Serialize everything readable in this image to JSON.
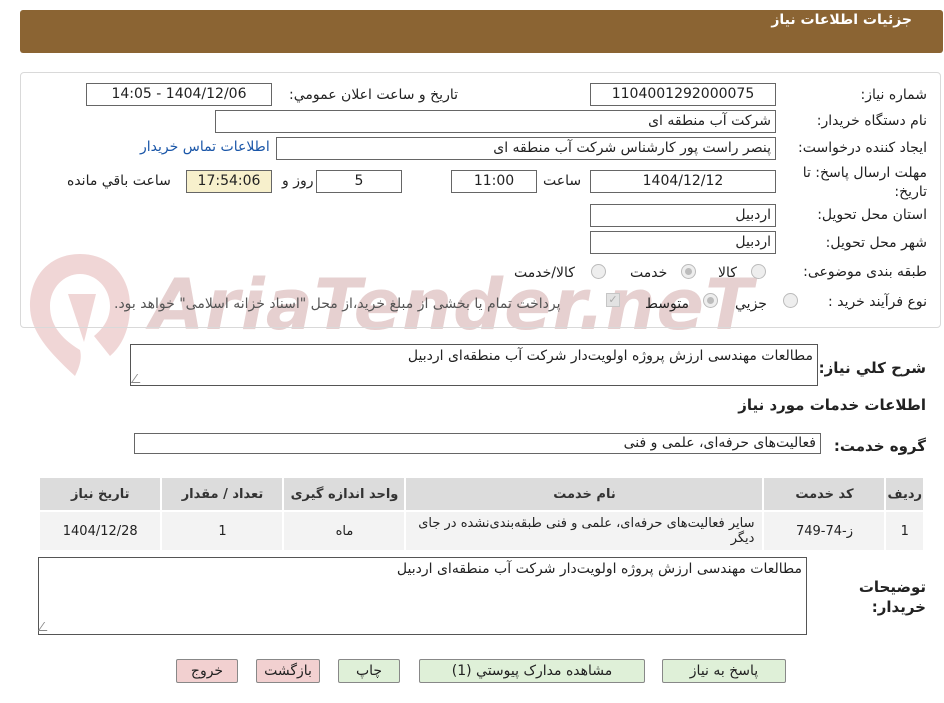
{
  "header": {
    "title": "جزئیات اطلاعات نیاز"
  },
  "watermark": "AriaTender.neT",
  "form": {
    "need_number_label": "شماره نیاز:",
    "need_number": "1104001292000075",
    "announce_label": "تاریخ و ساعت اعلان عمومي:",
    "announce_value": "1404/12/06 - 14:05",
    "buyer_org_label": "نام دستگاه خريدار:",
    "buyer_org": "شرکت آب منطقه ای",
    "requester_label": "ايجاد کننده درخواست:",
    "requester": "پنصر راست پور کارشناس شرکت آب منطقه ای",
    "contact_link": "اطلاعات تماس خريدار",
    "deadline_label": "مهلت ارسال پاسخ: تا تاریخ:",
    "deadline_date": "1404/12/12",
    "time_label": "ساعت",
    "deadline_time": "11:00",
    "days_value": "5",
    "days_label": "روز و",
    "remaining_time": "17:54:06",
    "remaining_label": "ساعت باقي مانده",
    "province_label": "استان محل تحويل:",
    "province": "اردبیل",
    "city_label": "شهر محل تحويل:",
    "city": "اردبیل",
    "category_label": "طبقه بندی موضوعی:",
    "category_options": [
      "کالا",
      "خدمت",
      "کالا/خدمت"
    ],
    "category_selected": "خدمت",
    "process_label": "نوع فرآیند خرید :",
    "process_options": [
      "جزيي",
      "متوسط"
    ],
    "process_selected": "متوسط",
    "payment_note": "پرداخت تمام یا بخشی از مبلغ خرید،از محل \"اسناد خزانه اسلامی\" خواهد بود."
  },
  "summary": {
    "label": "شرح کلي نياز:",
    "value": "مطالعات مهندسی ارزش پروژه اولویت‌دار شرکت آب منطقه‌ای اردبیل"
  },
  "services": {
    "section_title": "اطلاعات خدمات مورد نياز",
    "group_label": "گروه خدمت:",
    "group_value": "فعالیت‌های حرفه‌ای، علمی و فنی",
    "columns": [
      "رديف",
      "کد خدمت",
      "نام خدمت",
      "واحد اندازه گیری",
      "تعداد / مقدار",
      "تاریخ نیاز"
    ],
    "rows": [
      {
        "row": "1",
        "code": "ز-74-749",
        "name": "سایر فعالیت‌های حرفه‌ای، علمی و فنی طبقه‌بندی‌نشده در جای دیگر",
        "unit": "ماه",
        "qty": "1",
        "date": "1404/12/28"
      }
    ]
  },
  "buyer_notes": {
    "label": "توضيحات خريدار:",
    "value": "مطالعات مهندسی ارزش پروژه اولویت‌دار شرکت آب منطقه‌ای اردبیل"
  },
  "buttons": {
    "reply": "پاسخ به نياز",
    "attachments": "مشاهده مدارک پيوستي (1)",
    "print": "چاپ",
    "back": "بازگشت",
    "exit": "خروج"
  }
}
